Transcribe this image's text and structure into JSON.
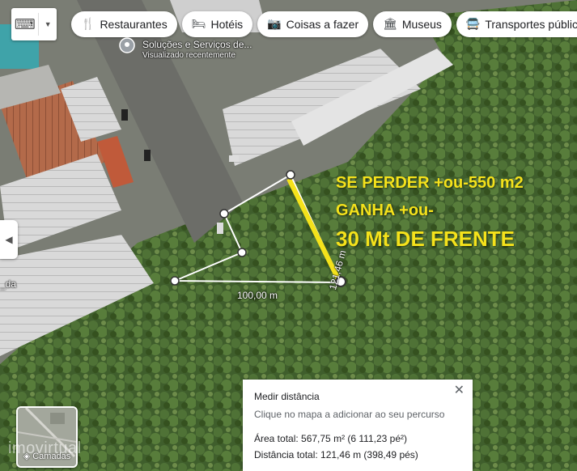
{
  "chips": [
    {
      "icon": "fork-knife-icon",
      "glyph": "🍴",
      "label": "Restaurantes"
    },
    {
      "icon": "bed-icon",
      "glyph": "🛏",
      "label": "Hotéis"
    },
    {
      "icon": "camera-icon",
      "glyph": "📷",
      "label": "Coisas a fazer"
    },
    {
      "icon": "museum-icon",
      "glyph": "🏛",
      "label": "Museus"
    },
    {
      "icon": "bus-icon",
      "glyph": "🚍",
      "label": "Transportes público"
    }
  ],
  "place": {
    "name": "Soluções e Serviços de...",
    "sub": "Visualizado recentemente"
  },
  "overlay": {
    "line1": "SE PERDER +ou-550 m2",
    "line2": "GANHA +ou-",
    "line3": "30 Mt DE FRENTE"
  },
  "distance_labels": {
    "bottom": "100,00 m",
    "right": "121,46 m",
    "edge": "_da"
  },
  "measure": {
    "title": "Medir distância",
    "hint": "Clique no mapa a adicionar ao seu percurso",
    "area": "Área total: 567,75 m² (6 111,23 pé²)",
    "distance": "Distância total: 121,46 m (398,49 pés)",
    "close_glyph": "✕"
  },
  "layers": {
    "label": "Camadas"
  },
  "watermark": "imovirtual",
  "colors": {
    "highlight": "#f5e21b",
    "road": "#6f6f6b",
    "vegetation": "#3f5e2c"
  }
}
